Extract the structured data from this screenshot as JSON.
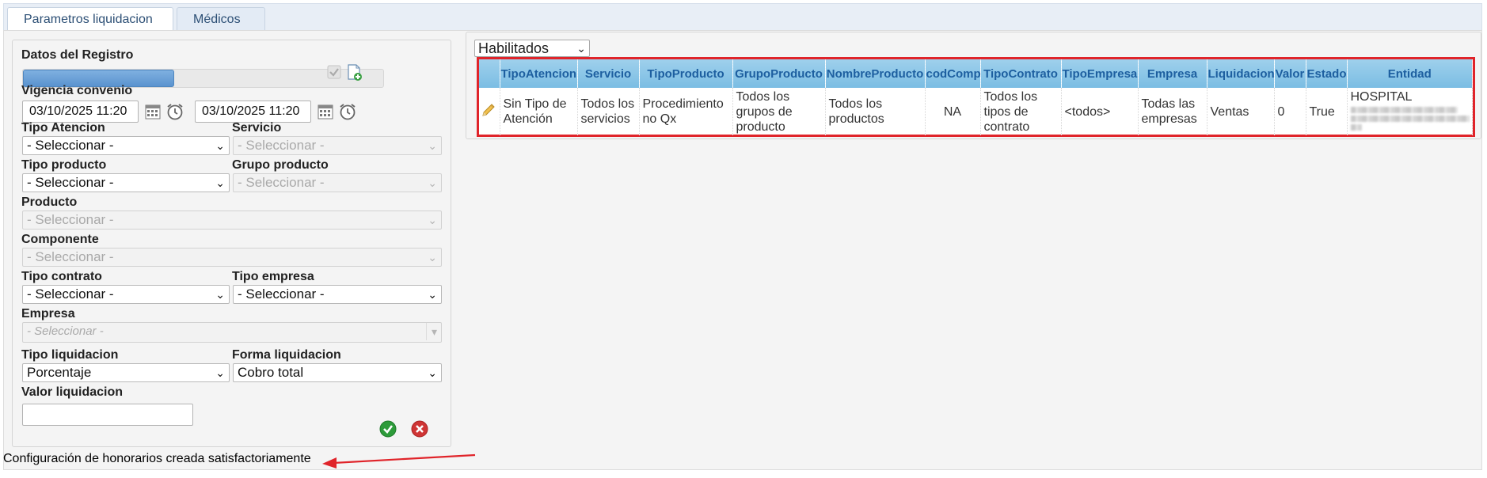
{
  "tabs": [
    {
      "label": "Parametros liquidacion",
      "active": true
    },
    {
      "label": "Médicos",
      "active": false
    }
  ],
  "form": {
    "section_title": "Datos del Registro",
    "progress_fraction": 0.42,
    "vigencia_label": "Vigencia convenio",
    "fecha_inicio": "03/10/2025 11:20",
    "fecha_fin": "03/10/2025 11:20",
    "tipo_atencion": {
      "label": "Tipo Atencion",
      "value": "- Seleccionar -"
    },
    "servicio": {
      "label": "Servicio",
      "value": "- Seleccionar -"
    },
    "tipo_producto": {
      "label": "Tipo producto",
      "value": "- Seleccionar -"
    },
    "grupo_producto": {
      "label": "Grupo producto",
      "value": "- Seleccionar -"
    },
    "producto": {
      "label": "Producto",
      "value": "- Seleccionar -"
    },
    "componente": {
      "label": "Componente",
      "value": "- Seleccionar -"
    },
    "tipo_contrato": {
      "label": "Tipo contrato",
      "value": "- Seleccionar -"
    },
    "tipo_empresa": {
      "label": "Tipo empresa",
      "value": "- Seleccionar -"
    },
    "empresa": {
      "label": "Empresa",
      "value": "- Seleccionar -"
    },
    "tipo_liquidacion": {
      "label": "Tipo liquidacion",
      "value": "Porcentaje"
    },
    "forma_liquidacion": {
      "label": "Forma liquidacion",
      "value": "Cobro total"
    },
    "valor_liquidacion": {
      "label": "Valor liquidacion",
      "value": ""
    }
  },
  "grid": {
    "filter_value": "Habilitados",
    "columns": [
      "TipoAtencion",
      "Servicio",
      "TipoProducto",
      "GrupoProducto",
      "NombreProducto",
      "codComp",
      "TipoContrato",
      "TipoEmpresa",
      "Empresa",
      "Liquidacion",
      "Valor",
      "Estado",
      "Entidad"
    ],
    "rows": [
      {
        "TipoAtencion": "Sin Tipo de Atención",
        "Servicio": "Todos los servicios",
        "TipoProducto": "Procedimiento no Qx",
        "GrupoProducto": "Todos los grupos de producto",
        "NombreProducto": "Todos los productos",
        "codComp": "NA",
        "TipoContrato": "Todos los tipos de contrato",
        "TipoEmpresa": "<todos>",
        "Empresa": "Todas las empresas",
        "Liquidacion": "Ventas",
        "Valor": "0",
        "Estado": "True",
        "Entidad": "HOSPITAL"
      }
    ]
  },
  "status_message": "Configuración de honorarios creada satisfactoriamente",
  "colors": {
    "accent": "#2c4f75",
    "header": "#7bbde3",
    "highlight_border": "#e0242a",
    "arrow": "#e0242a"
  }
}
